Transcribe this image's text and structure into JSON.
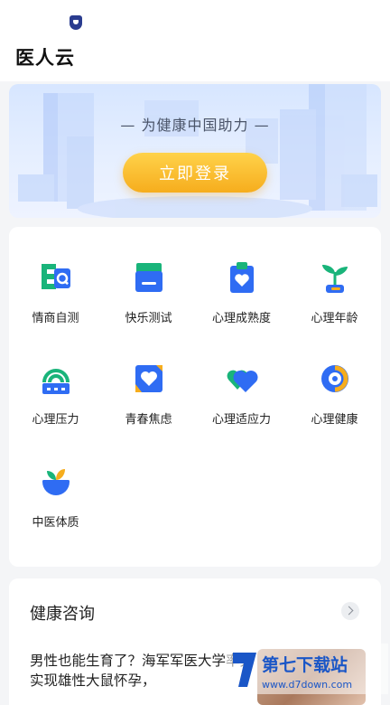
{
  "app": {
    "title": "医人云"
  },
  "banner": {
    "slogan": "— 为健康中国助力 —",
    "login_label": "立即登录"
  },
  "tests": [
    {
      "label": "情商自测"
    },
    {
      "label": "快乐测试"
    },
    {
      "label": "心理成熟度"
    },
    {
      "label": "心理年龄"
    },
    {
      "label": "心理压力"
    },
    {
      "label": "青春焦虑"
    },
    {
      "label": "心理适应力"
    },
    {
      "label": "心理健康"
    },
    {
      "label": "中医体质"
    }
  ],
  "consult": {
    "title": "健康咨询",
    "article_title": "男性也能生育了？海军军医大学率先实现雄性大鼠怀孕，"
  },
  "watermark": {
    "name": "第七下载站",
    "url": "www.d7down.com"
  },
  "colors": {
    "accent_blue": "#2f6cf3",
    "accent_orange": "#f6ad1d",
    "accent_green": "#19b47a"
  }
}
